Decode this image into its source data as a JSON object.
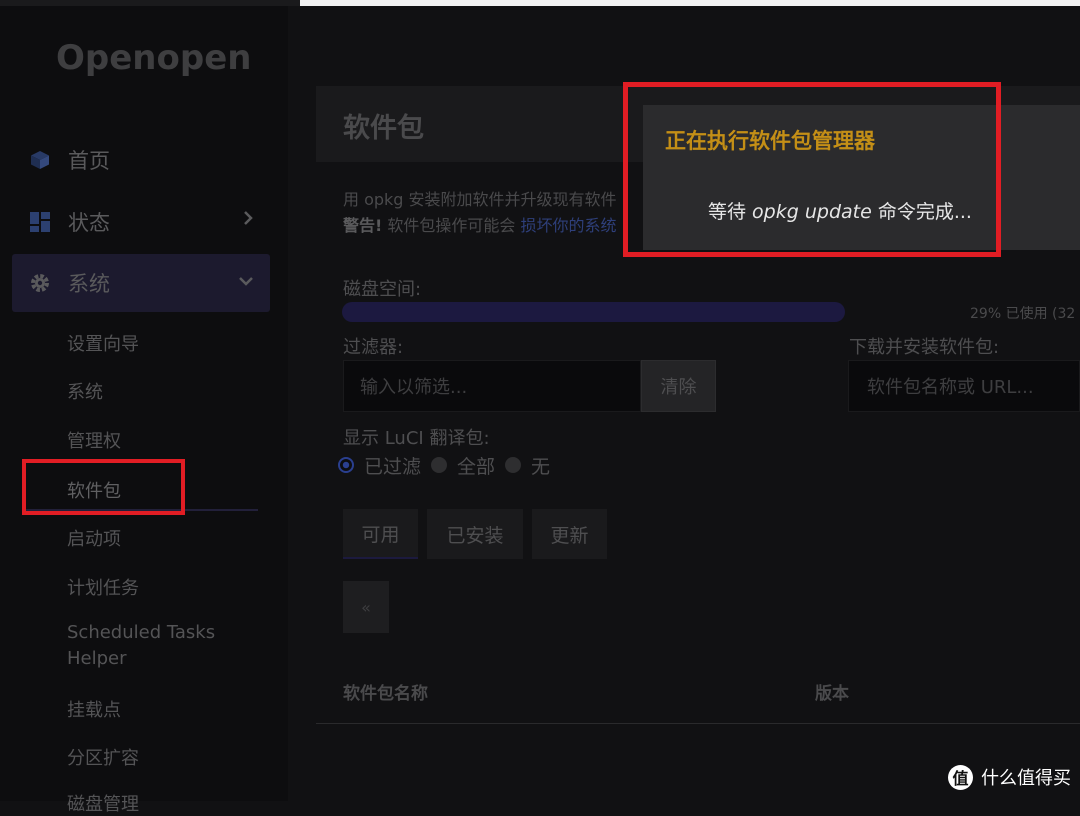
{
  "app": {
    "logo": "Openopen"
  },
  "sidebar": {
    "items": [
      {
        "label": "首页",
        "icon": "cube-icon"
      },
      {
        "label": "状态",
        "icon": "dashboard-icon"
      },
      {
        "label": "系统",
        "icon": "gear-icon"
      }
    ],
    "subitems": [
      "设置向导",
      "系统",
      "管理权",
      "软件包",
      "启动项",
      "计划任务",
      "Scheduled Tasks",
      "Helper",
      "挂载点",
      "分区扩容",
      "磁盘管理"
    ]
  },
  "main": {
    "title": "软件包",
    "description_line1": "用 opkg 安装附加软件并升级现有软件",
    "warning_label": "警告!",
    "warning_text": " 软件包操作可能会 ",
    "warning_link": "损坏你的系统",
    "disk_label": "磁盘空间:",
    "disk_usage_percent": 29,
    "disk_usage_text": "29% 已使用 (32",
    "filter_label": "过滤器:",
    "filter_placeholder": "输入以筛选...",
    "clear_button": "清除",
    "download_label": "下载并安装软件包:",
    "download_placeholder": "软件包名称或 URL...",
    "luci_label": "显示 LuCI 翻译包:",
    "luci_options": [
      "已过滤",
      "全部",
      "无"
    ],
    "luci_selected": "已过滤",
    "tabs": [
      "可用",
      "已安装",
      "更新"
    ],
    "active_tab": "可用",
    "pager_prev": "«",
    "table_headers": {
      "name": "软件包名称",
      "version": "版本"
    }
  },
  "modal": {
    "title": "正在执行软件包管理器",
    "msg_prefix": "等待 ",
    "msg_command": "opkg update",
    "msg_suffix": " 命令完成..."
  },
  "watermark": {
    "icon_char": "值",
    "text": "什么值得买"
  },
  "colors": {
    "accent_purple": "#1c1940",
    "modal_title": "#c48f16",
    "highlight_red": "#e11d24"
  }
}
